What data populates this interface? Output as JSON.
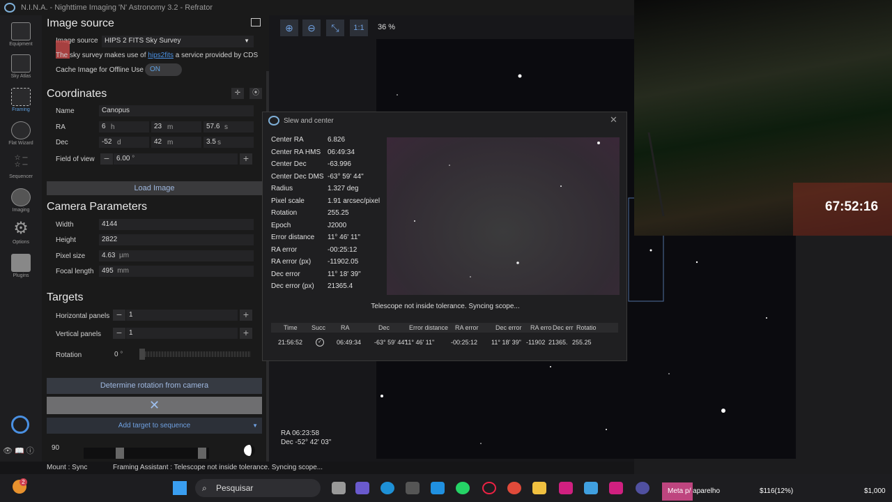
{
  "window": {
    "title": "N.I.N.A. - Nighttime Imaging 'N' Astronomy 3.2   -  Refrator"
  },
  "nav": [
    {
      "label": "Equipment",
      "icon": "telescope-icon"
    },
    {
      "label": "Sky Atlas",
      "icon": "sky-atlas-icon"
    },
    {
      "label": "Framing",
      "icon": "framing-icon"
    },
    {
      "label": "Flat Wizard",
      "icon": "flat-wizard-icon"
    },
    {
      "label": "Sequencer",
      "icon": "sequencer-icon"
    },
    {
      "label": "Imaging",
      "icon": "imaging-icon"
    },
    {
      "label": "Options",
      "icon": "gear-icon"
    },
    {
      "label": "Plugins",
      "icon": "puzzle-icon"
    }
  ],
  "image_source": {
    "heading": "Image source",
    "label": "Image source",
    "value": "HIPS 2 FITS Sky Survey",
    "info_pre": "The sky survey makes use of ",
    "info_link": "hips2fits",
    "info_post": " a service provided by CDS",
    "cache_label": "Cache Image for Offline Use",
    "cache_toggle": "ON"
  },
  "coordinates": {
    "heading": "Coordinates",
    "name_label": "Name",
    "name_value": "Canopus",
    "ra_label": "RA",
    "ra_h": "6",
    "ra_h_unit": "h",
    "ra_m": "23",
    "ra_m_unit": "m",
    "ra_s": "57.6",
    "ra_s_unit": "s",
    "dec_label": "Dec",
    "dec_d": "-52",
    "dec_d_unit": "d",
    "dec_m": "42",
    "dec_m_unit": "m",
    "dec_s": "3.5",
    "dec_s_unit": "s",
    "fov_label": "Field of view",
    "fov_value": "6.00",
    "fov_unit": "°",
    "load_button": "Load Image"
  },
  "camera": {
    "heading": "Camera Parameters",
    "width_label": "Width",
    "width_value": "4144",
    "height_label": "Height",
    "height_value": "2822",
    "pixel_label": "Pixel size",
    "pixel_value": "4.63",
    "pixel_unit": "µm",
    "focal_label": "Focal length",
    "focal_value": "495",
    "focal_unit": "mm"
  },
  "targets": {
    "heading": "Targets",
    "hpanels_label": "Horizontal panels",
    "hpanels_value": "1",
    "vpanels_label": "Vertical panels",
    "vpanels_value": "1",
    "rotation_label": "Rotation",
    "rotation_value": "0",
    "rotation_unit": "°",
    "determine_button": "Determine rotation from camera",
    "add_button": "Add target to sequence",
    "bottom_value": "90"
  },
  "map_toolbar": {
    "one_to_one": "1:1",
    "zoom": "36 %"
  },
  "map_coords": {
    "ra": "RA 06:23:58",
    "dec": "Dec -52° 42' 03\""
  },
  "dialog": {
    "title": "Slew and center",
    "rows": [
      {
        "k": "Center RA",
        "v": "6.826"
      },
      {
        "k": "Center RA HMS",
        "v": "06:49:34"
      },
      {
        "k": "Center Dec",
        "v": "-63.996"
      },
      {
        "k": "Center Dec DMS",
        "v": "-63° 59' 44\""
      },
      {
        "k": "Radius",
        "v": "1.327 deg"
      },
      {
        "k": "Pixel scale",
        "v": "1.91 arcsec/pixel"
      },
      {
        "k": "Rotation",
        "v": "255.25"
      },
      {
        "k": "Epoch",
        "v": "J2000"
      },
      {
        "k": "Error distance",
        "v": "11° 46' 11\""
      },
      {
        "k": "RA error",
        "v": "-00:25:12"
      },
      {
        "k": "RA error (px)",
        "v": "-11902.05"
      },
      {
        "k": "Dec error",
        "v": "11° 18' 39\""
      },
      {
        "k": "Dec error (px)",
        "v": "21365.4"
      }
    ],
    "message": "Telescope not inside tolerance. Syncing scope...",
    "table_headers": [
      "Time",
      "Succ",
      "RA",
      "Dec",
      "Error distance",
      "RA error",
      "Dec error",
      "RA erro",
      "Dec err",
      "Rotatio"
    ],
    "table_row": [
      "21:56:52",
      "",
      "06:49:34",
      "-63° 59' 44\"",
      "11° 46' 11\"",
      "-00:25:12",
      "11° 18' 39\"",
      "-11902",
      "21365.",
      "255.25"
    ]
  },
  "webcam": {
    "timer": "67:52:16"
  },
  "statusbar": {
    "mount": "Mount :  Sync",
    "framing": "Framing Assistant :  Telescope not inside tolerance. Syncing scope..."
  },
  "taskbar": {
    "search": "Pesquisar",
    "notice": "Meta p/ aparelho",
    "money1": "$116(12%)",
    "money2": "$1,000",
    "badge": "2"
  }
}
